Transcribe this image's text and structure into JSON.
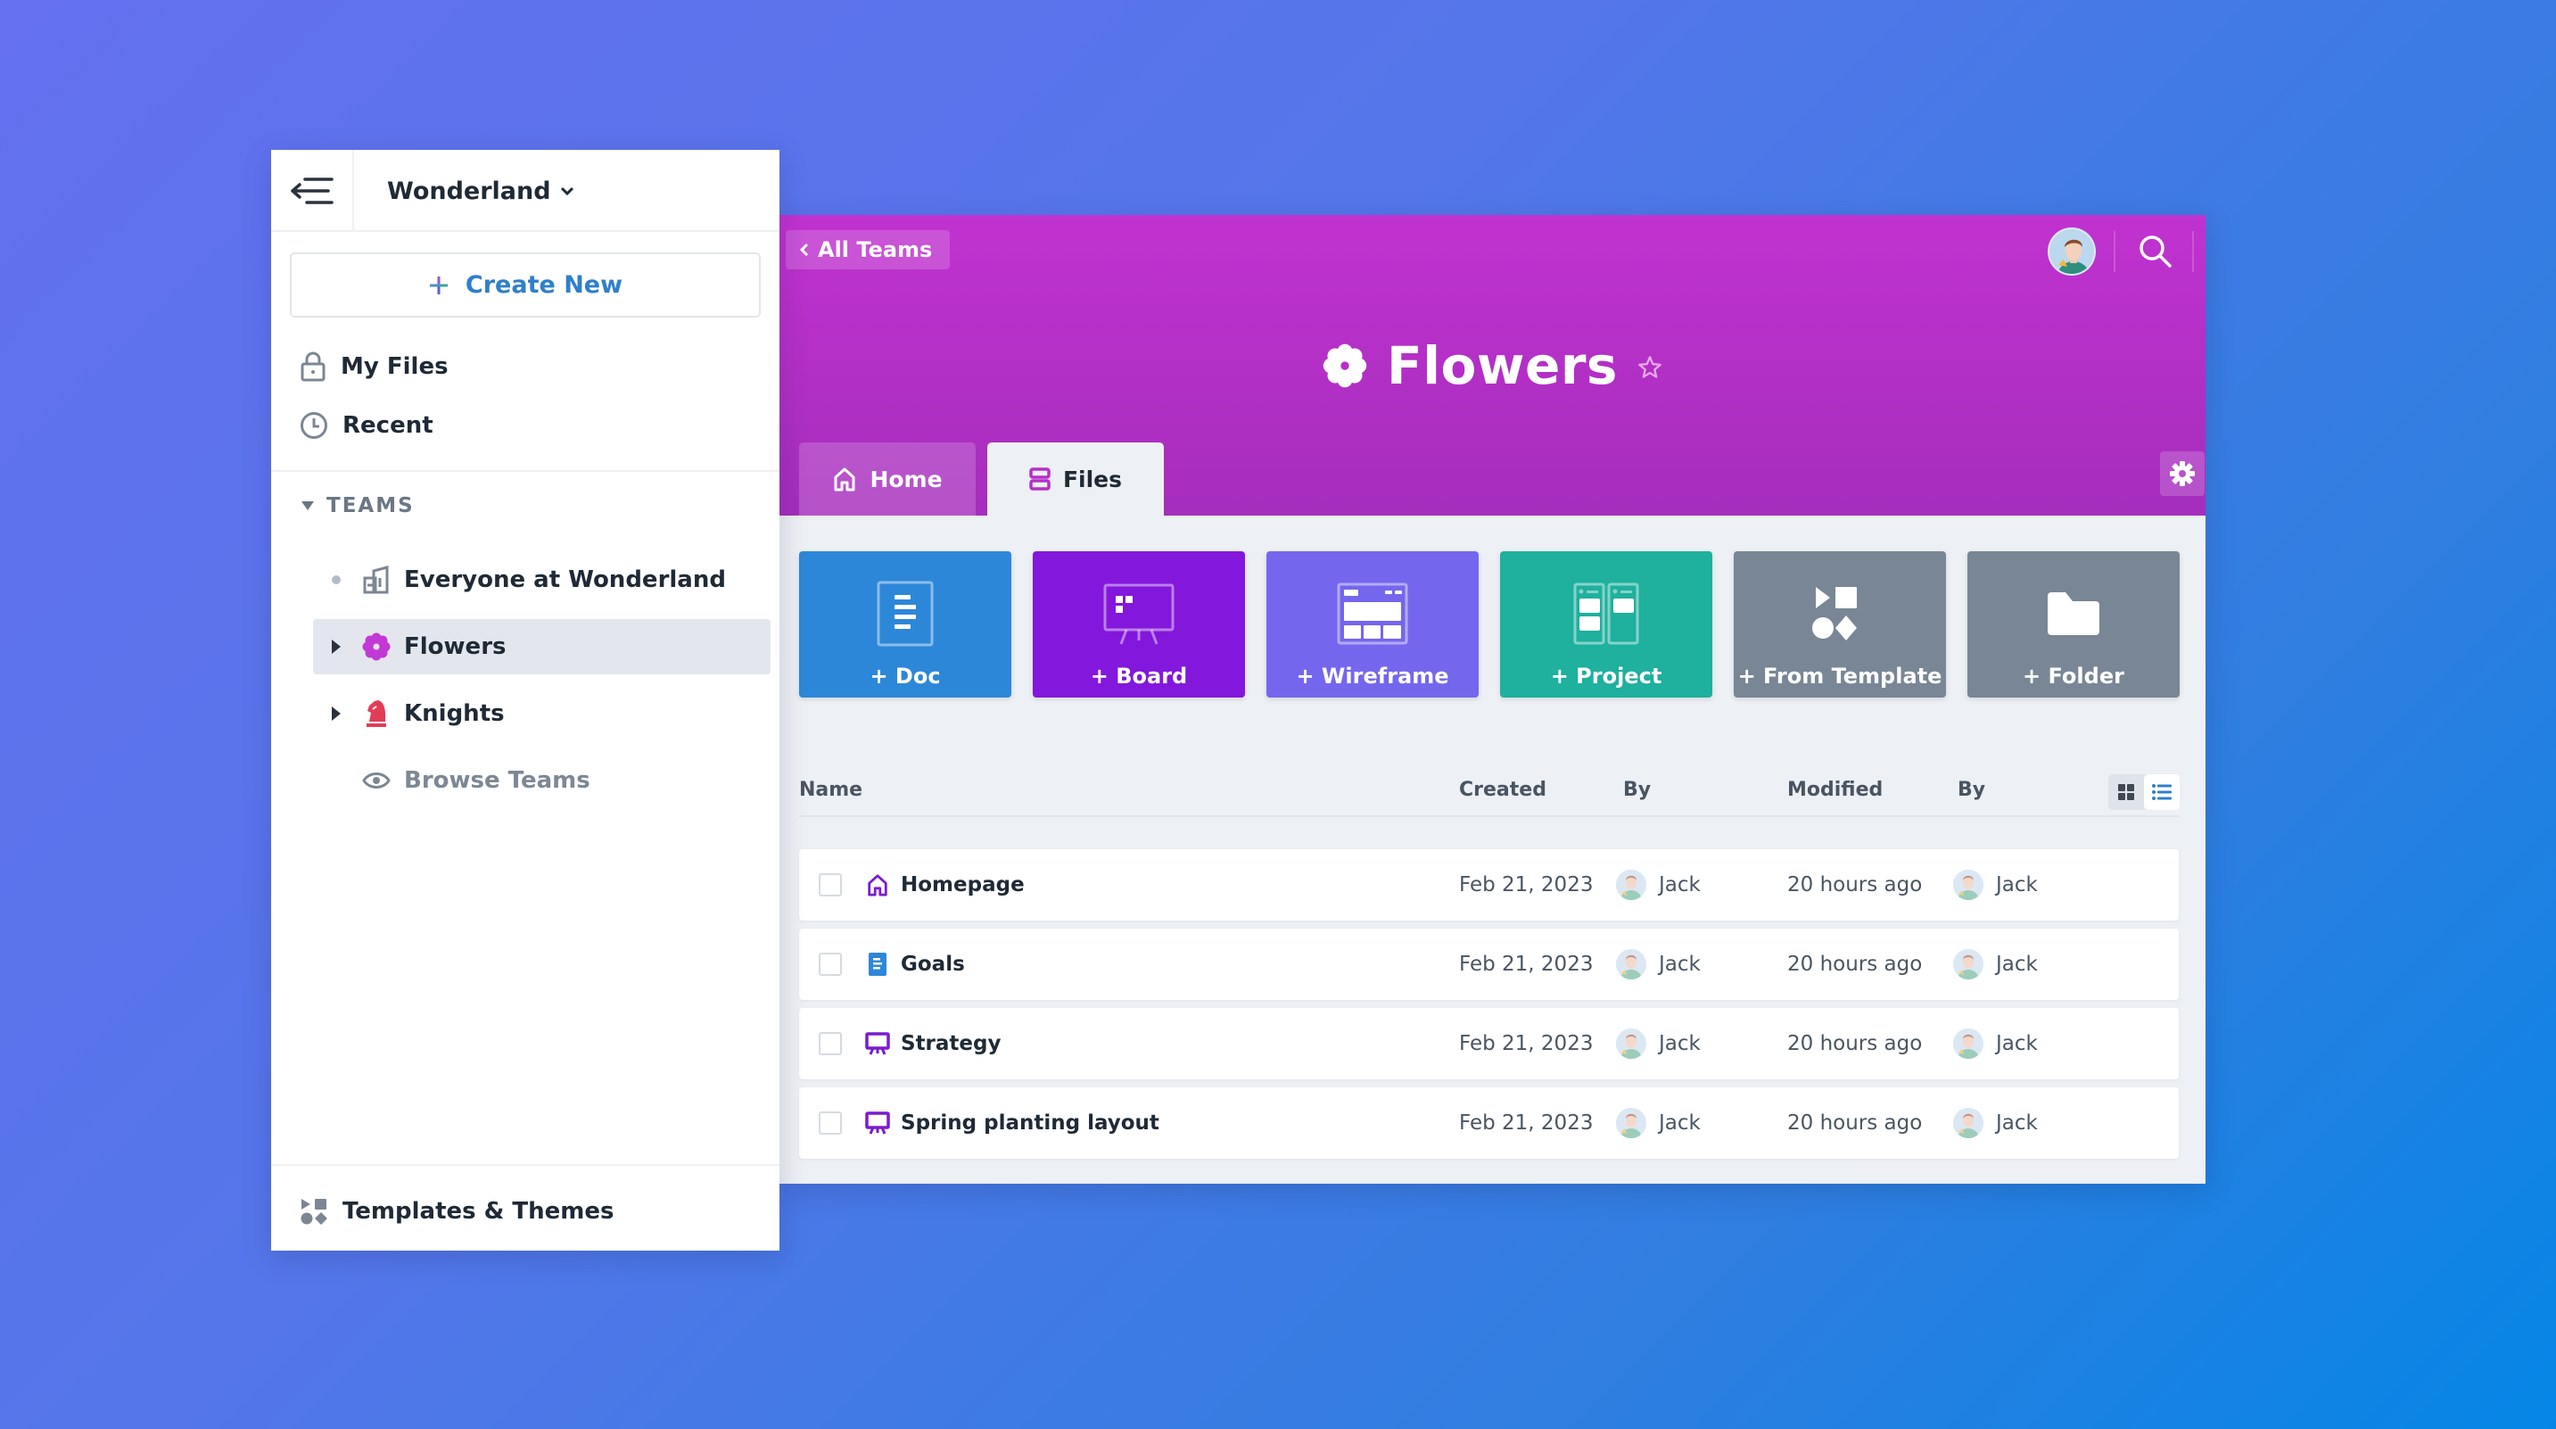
{
  "colors": {
    "hero_purple": "#b52fc8",
    "accent_blue": "#2f80c9",
    "tile_doc": "#2d87d8",
    "tile_board": "#8317dc",
    "tile_wireframe": "#7566ee",
    "tile_project": "#1fb09e",
    "tile_template": "#788695",
    "tile_folder": "#788695",
    "flowers_icon": "#c23ad6",
    "knights_icon": "#e23d57",
    "board_icon": "#7a1bd0",
    "doc_icon": "#2d87d8"
  },
  "sidebar": {
    "collapse_icon": "collapse-menu-icon",
    "workspace": "Wonderland",
    "create_new": "Create New",
    "nav": [
      {
        "label": "My Files",
        "icon": "lock-icon"
      },
      {
        "label": "Recent",
        "icon": "clock-icon"
      }
    ],
    "teams_label": "TEAMS",
    "teams": [
      {
        "label": "Everyone at Wonderland",
        "icon": "building-icon",
        "active": false
      },
      {
        "label": "Flowers",
        "icon": "flower-icon",
        "active": true
      },
      {
        "label": "Knights",
        "icon": "knight-icon",
        "active": false
      },
      {
        "label": "Browse Teams",
        "icon": "eye-icon",
        "active": false
      }
    ],
    "footer": {
      "label": "Templates & Themes",
      "icon": "shapes-icon"
    }
  },
  "main": {
    "back_label": "All Teams",
    "title": "Flowers",
    "tabs": [
      {
        "label": "Home",
        "icon": "home-icon",
        "active": false
      },
      {
        "label": "Files",
        "icon": "files-icon",
        "active": true
      }
    ],
    "create_tiles": [
      {
        "label": "+ Doc",
        "icon": "doc-icon"
      },
      {
        "label": "+ Board",
        "icon": "board-icon"
      },
      {
        "label": "+ Wireframe",
        "icon": "wireframe-icon"
      },
      {
        "label": "+ Project",
        "icon": "project-icon"
      },
      {
        "label": "+ From Template",
        "icon": "template-icon"
      },
      {
        "label": "+ Folder",
        "icon": "folder-icon"
      }
    ],
    "table": {
      "columns": [
        "Name",
        "Created",
        "By",
        "Modified",
        "By"
      ],
      "view_mode": "list",
      "rows": [
        {
          "name": "Homepage",
          "type": "home",
          "created": "Feb 21, 2023",
          "created_by": "Jack",
          "modified": "20 hours ago",
          "modified_by": "Jack"
        },
        {
          "name": "Goals",
          "type": "doc",
          "created": "Feb 21, 2023",
          "created_by": "Jack",
          "modified": "20 hours ago",
          "modified_by": "Jack"
        },
        {
          "name": "Strategy",
          "type": "board",
          "created": "Feb 21, 2023",
          "created_by": "Jack",
          "modified": "20 hours ago",
          "modified_by": "Jack"
        },
        {
          "name": "Spring planting layout",
          "type": "board",
          "created": "Feb 21, 2023",
          "created_by": "Jack",
          "modified": "20 hours ago",
          "modified_by": "Jack"
        }
      ]
    }
  }
}
